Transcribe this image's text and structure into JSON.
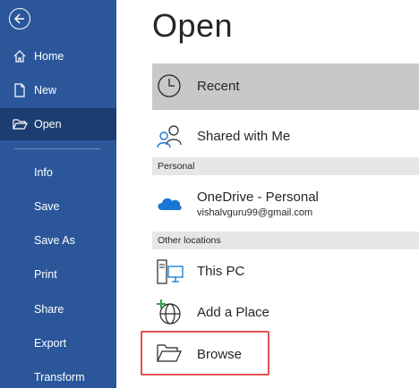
{
  "sidebar": {
    "items": [
      {
        "label": "Home"
      },
      {
        "label": "New"
      },
      {
        "label": "Open"
      },
      {
        "label": "Info"
      },
      {
        "label": "Save"
      },
      {
        "label": "Save As"
      },
      {
        "label": "Print"
      },
      {
        "label": "Share"
      },
      {
        "label": "Export"
      },
      {
        "label": "Transform"
      }
    ],
    "active": "Open"
  },
  "main": {
    "title": "Open",
    "recent_label": "Recent",
    "shared_label": "Shared with Me",
    "personal_header": "Personal",
    "onedrive": {
      "label": "OneDrive - Personal",
      "email": "vishalvguru99@gmail.com"
    },
    "other_header": "Other locations",
    "thispc_label": "This PC",
    "addplace_label": "Add a Place",
    "browse_label": "Browse"
  },
  "colors": {
    "sidebar": "#2b579a",
    "sidebar_active": "#1b3d70",
    "highlight": "#e05252",
    "onedrive": "#1877d2"
  }
}
